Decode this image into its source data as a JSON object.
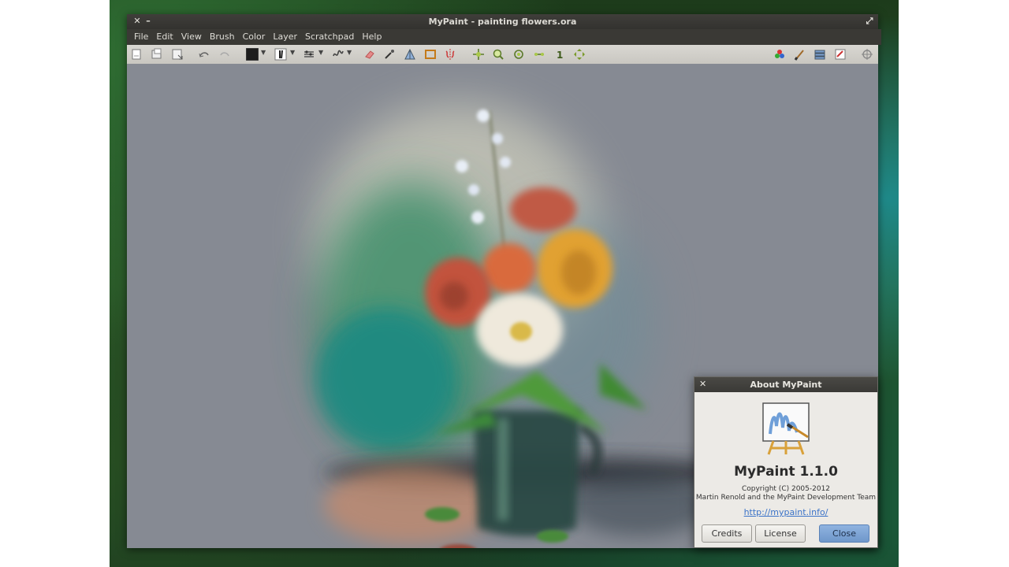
{
  "window": {
    "title": "MyPaint - painting flowers.ora"
  },
  "menubar": {
    "items": [
      "File",
      "Edit",
      "View",
      "Brush",
      "Color",
      "Layer",
      "Scratchpad",
      "Help"
    ]
  },
  "colors": {
    "canvas_bg": "#868a93",
    "titlebar": "#3a3935",
    "toolbar": "#d0cec8",
    "accent_button": "#7ea3d6",
    "link": "#3b73c8"
  },
  "toolbar": {
    "icons": [
      "new-document-icon",
      "open-document-icon",
      "save-document-icon",
      "undo-icon",
      "redo-icon",
      "color-swatch-icon",
      "brush-settings-icon",
      "dab-settings-icon",
      "stroke-settings-icon",
      "eraser-icon",
      "eyedropper-icon",
      "fill-icon",
      "frame-icon",
      "symmetry-icon",
      "pan-icon",
      "zoom-icon",
      "rotate-icon",
      "flip-icon",
      "layer-move-icon",
      "fit-view-icon",
      "color-palette-icon",
      "brush-library-icon",
      "layers-icon",
      "scratchpad-icon",
      "settings-crosshair-icon"
    ]
  },
  "about_dialog": {
    "title": "About MyPaint",
    "app_name": "MyPaint 1.1.0",
    "copyright_line1": "Copyright (C) 2005-2012",
    "copyright_line2": "Martin Renold and the MyPaint Development Team",
    "link": "http://mypaint.info/",
    "buttons": {
      "credits": "Credits",
      "license": "License",
      "close": "Close"
    }
  }
}
